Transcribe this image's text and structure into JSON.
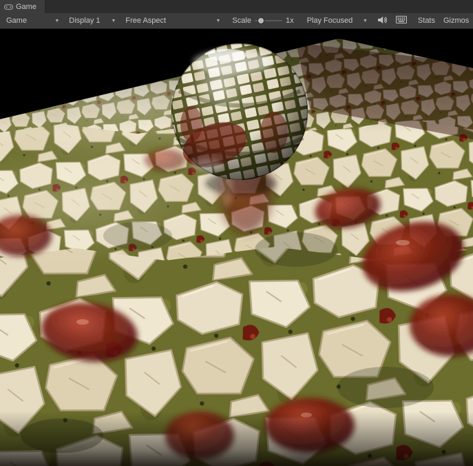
{
  "tab": {
    "label": "Game"
  },
  "icons": {
    "chevron_down": "▼",
    "tab_icon": "gamepad-icon",
    "mute_icon": "speaker-icon",
    "shortcuts_icon": "keyboard-grid-icon"
  },
  "toolbar": {
    "game_dropdown": {
      "label": "Game"
    },
    "display_dropdown": {
      "label": "Display 1"
    },
    "aspect_dropdown": {
      "label": "Free Aspect"
    },
    "scale": {
      "label": "Scale",
      "value": "1x"
    },
    "play_focused_dropdown": {
      "label": "Play Focused"
    },
    "stats_button": {
      "label": "Stats"
    },
    "gizmos_dropdown": {
      "label": "Gizmos"
    }
  },
  "scene": {
    "colors": {
      "sky": "#000000",
      "moss": "#6b6e2c",
      "stone": "#e9dfc6",
      "red_glaze": "#7c1a10"
    }
  }
}
